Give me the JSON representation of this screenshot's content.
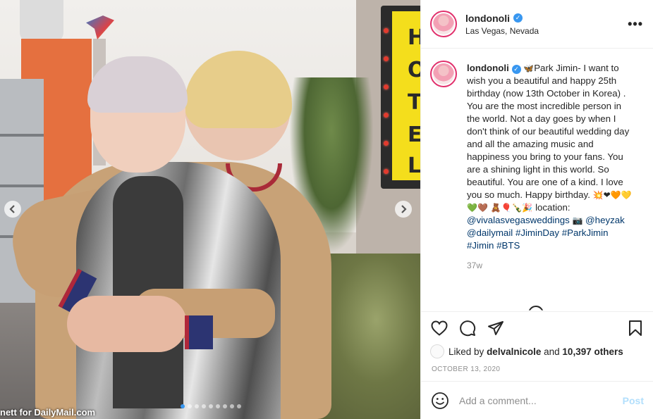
{
  "media": {
    "watermark": "nett for DailyMail.com",
    "hotel_letters": [
      "H",
      "O",
      "T",
      "E",
      "L"
    ],
    "prev_icon": "chevron-left-icon",
    "next_icon": "chevron-right-icon",
    "carousel_dots": 9,
    "carousel_active_index": 0,
    "accent_color": "#3897f0"
  },
  "header": {
    "username": "londonoli",
    "location": "Las Vegas, Nevada",
    "more_icon": "more-options-icon",
    "more_label": "•••"
  },
  "caption": {
    "username": "londonoli",
    "emojis_lead": "🦋",
    "text_1": "Park Jimin- I want to wish you a beautiful and happy 25th birthday (now 13th October in Korea) . You are the most incredible person in the world. Not a day goes by when I don't think of our beautiful wedding day and all the amazing music and happiness you bring to your fans. You are a shining light in this world. So beautiful. You are one of a kind. I love you so much. Happy birthday.",
    "emojis_hearts": "💥❤🧡💛💚🤎",
    "emojis_misc": "🧸🎈🍾🎉",
    "text_2": "location:",
    "mention_1": "@vivalasvegasweddings",
    "emoji_camera": "📷",
    "mention_2": "@heyzak",
    "mention_3": "@dailymail",
    "hashtag_1": "#JiminDay",
    "hashtag_2": "#ParkJimin",
    "hashtag_3": "#Jimin",
    "hashtag_4": "#BTS",
    "time_ago": "37w"
  },
  "actions": {
    "like_icon": "heart-icon",
    "comment_icon": "comment-icon",
    "share_icon": "share-icon",
    "save_icon": "bookmark-icon",
    "liked_by_prefix": "Liked by",
    "liked_by_user": "delvalnicole",
    "liked_by_and": "and",
    "liked_by_count": "10,397 others",
    "date": "OCTOBER 13, 2020"
  },
  "comment_box": {
    "emoji_icon": "smiley-icon",
    "placeholder": "Add a comment...",
    "post_label": "Post",
    "post_color_disabled": "#b2dffc"
  },
  "colors": {
    "text": "#262626",
    "secondary": "#8e8e8e",
    "link": "#00376b",
    "border": "#efefef",
    "verified": "#3897f0"
  }
}
